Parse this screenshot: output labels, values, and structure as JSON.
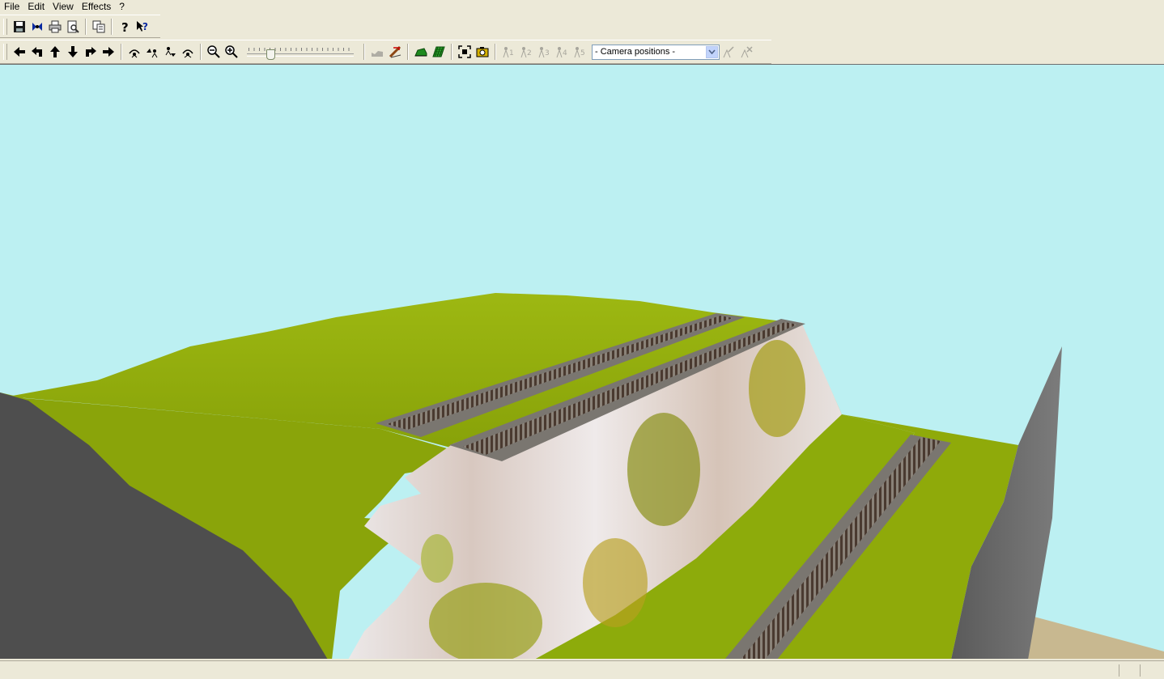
{
  "menu": {
    "items": [
      {
        "label": "File"
      },
      {
        "label": "Edit"
      },
      {
        "label": "View"
      },
      {
        "label": "Effects"
      },
      {
        "label": "?"
      }
    ]
  },
  "toolbar_main": {
    "buttons": [
      "save-icon",
      "open-layout-icon",
      "print-icon",
      "print-preview-icon",
      "copy-icon",
      "help-icon",
      "context-help-icon"
    ]
  },
  "toolbar_view": {
    "camera_combo": {
      "value": "- Camera positions -"
    },
    "camera_slots": [
      "1",
      "2",
      "3",
      "4",
      "5"
    ],
    "zoom_slider_fraction": 0.2
  },
  "colors": {
    "sky": "#bcf0f2",
    "grass": "#8faa0a",
    "grass_light": "#9dba14",
    "rock_grey": "#545454",
    "wall": "#747474",
    "chrome": "#ece9d8"
  }
}
